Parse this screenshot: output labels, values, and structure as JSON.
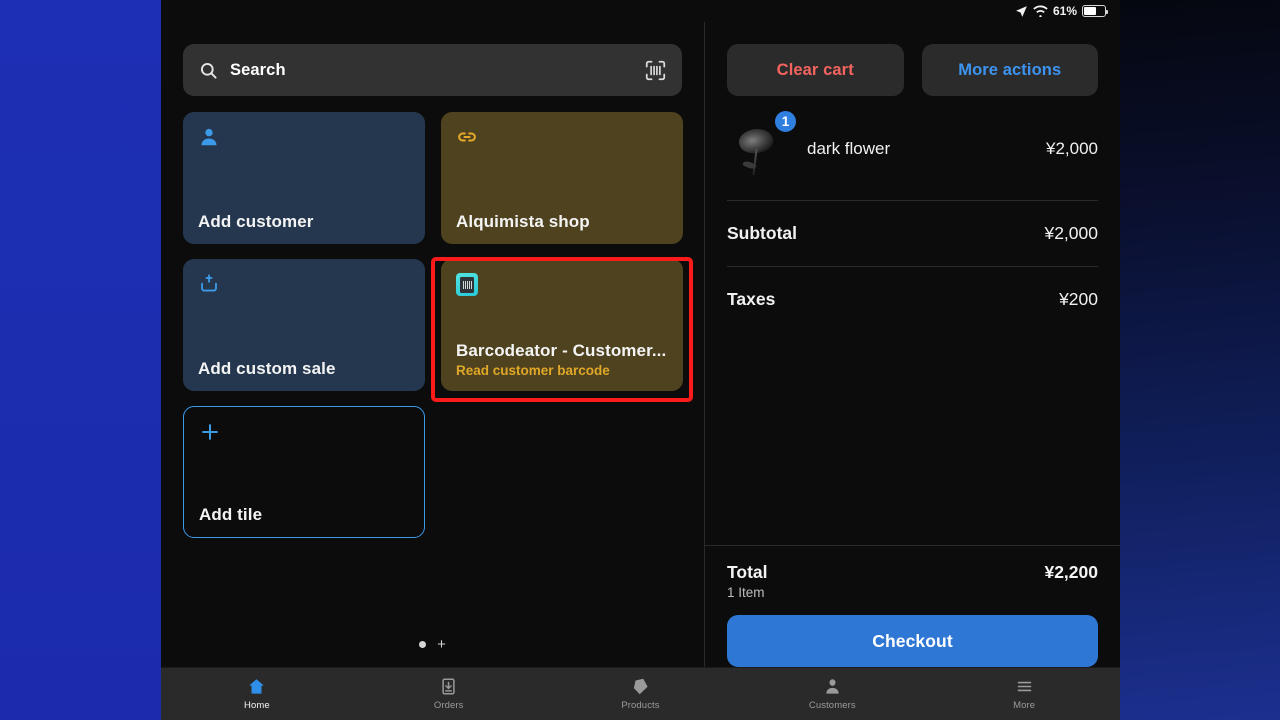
{
  "statusbar": {
    "battery_percent": "61%",
    "location_icon": "location-arrow-icon",
    "wifi_icon": "wifi-icon",
    "battery_icon": "battery-icon"
  },
  "search": {
    "placeholder": "Search",
    "icon": "search-icon",
    "scan_icon": "barcode-scan-icon"
  },
  "tiles": [
    {
      "title": "Add customer",
      "subtitle": "",
      "icon": "person-icon",
      "style": "blue"
    },
    {
      "title": "Alquimista shop",
      "subtitle": "",
      "icon": "link-icon",
      "style": "olive"
    },
    {
      "title": "Add custom sale",
      "subtitle": "",
      "icon": "tray-upload-icon",
      "style": "blue"
    },
    {
      "title": "Barcodeator - Customer...",
      "subtitle": "Read customer barcode",
      "icon": "barcodeator-app-icon",
      "style": "olive"
    },
    {
      "title": "Add tile",
      "subtitle": "",
      "icon": "plus-icon",
      "style": "outline"
    }
  ],
  "pager": {
    "dot_icon": "page-dot-icon",
    "add_page_label": "+"
  },
  "cart": {
    "clear_label": "Clear cart",
    "more_label": "More actions",
    "items": [
      {
        "name": "dark flower",
        "price": "¥2,000",
        "qty": "1",
        "thumb": "dark-rose-photo"
      }
    ],
    "lines": [
      {
        "label": "Subtotal",
        "value": "¥2,000"
      },
      {
        "label": "Taxes",
        "value": "¥200"
      }
    ],
    "total_label": "Total",
    "total_items": "1 Item",
    "total_value": "¥2,200",
    "checkout_label": "Checkout"
  },
  "tabbar": [
    {
      "label": "Home",
      "icon": "home-icon",
      "active": true
    },
    {
      "label": "Orders",
      "icon": "orders-icon",
      "active": false
    },
    {
      "label": "Products",
      "icon": "tag-icon",
      "active": false
    },
    {
      "label": "Customers",
      "icon": "person-icon",
      "active": false
    },
    {
      "label": "More",
      "icon": "hamburger-icon",
      "active": false
    }
  ],
  "colors": {
    "accent_blue": "#2f77d4",
    "danger_red": "#f4645f",
    "link_blue": "#3d94f0",
    "tile_blue": "#25374f",
    "tile_olive": "#4e421f",
    "highlight_red": "#fb1b1b",
    "subtitle_gold": "#e0a828"
  }
}
